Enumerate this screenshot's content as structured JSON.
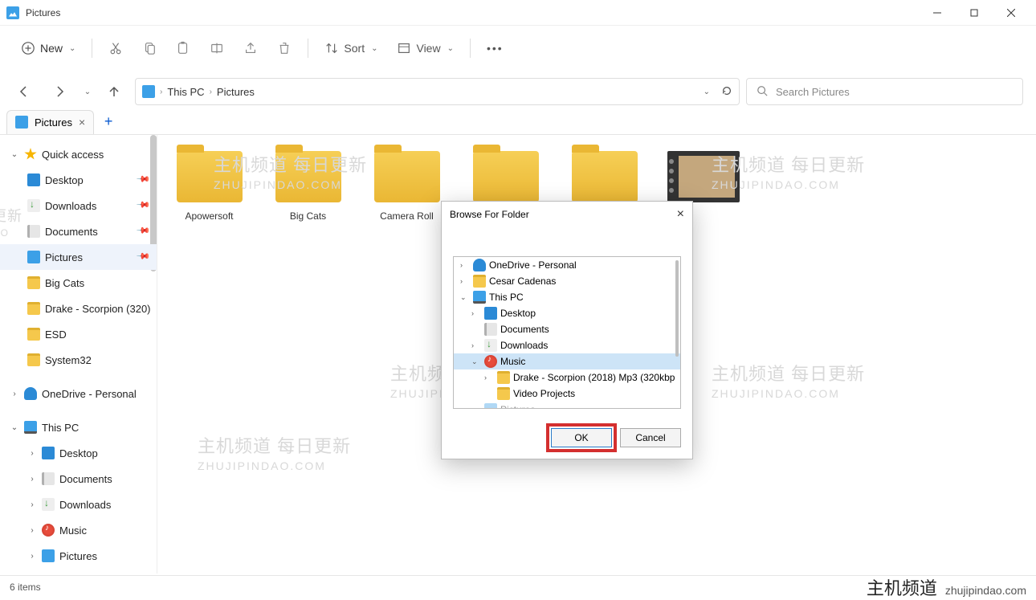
{
  "window": {
    "title": "Pictures"
  },
  "toolbar": {
    "new": "New",
    "sort": "Sort",
    "view": "View"
  },
  "breadcrumb": {
    "root": "This PC",
    "current": "Pictures"
  },
  "search": {
    "placeholder": "Search Pictures"
  },
  "tab": {
    "label": "Pictures"
  },
  "sidebar": {
    "quick": "Quick access",
    "desktop": "Desktop",
    "downloads": "Downloads",
    "documents": "Documents",
    "pictures": "Pictures",
    "bigcats": "Big Cats",
    "drake": "Drake - Scorpion (320)",
    "esd": "ESD",
    "system32": "System32",
    "onedrive": "OneDrive - Personal",
    "thispc": "This PC",
    "tp_desktop": "Desktop",
    "tp_documents": "Documents",
    "tp_downloads": "Downloads",
    "tp_music": "Music",
    "tp_pictures": "Pictures"
  },
  "folders": [
    {
      "name": "Apowersoft"
    },
    {
      "name": "Big Cats"
    },
    {
      "name": "Camera Roll"
    }
  ],
  "dialog": {
    "title": "Browse For Folder",
    "tree": {
      "onedrive": "OneDrive - Personal",
      "user": "Cesar Cadenas",
      "thispc": "This PC",
      "desktop": "Desktop",
      "documents": "Documents",
      "downloads": "Downloads",
      "music": "Music",
      "drake": "Drake - Scorpion (2018) Mp3 (320kbp",
      "video": "Video Projects",
      "pictures_cut": "Pictures"
    },
    "ok": "OK",
    "cancel": "Cancel"
  },
  "status": {
    "items": "6 items"
  },
  "watermark": {
    "cn": "主机频道 每日更新",
    "en": "ZHUJIPINDAO.COM",
    "brand_cn": "主机频道",
    "brand_en": "zhujipindao.com"
  }
}
